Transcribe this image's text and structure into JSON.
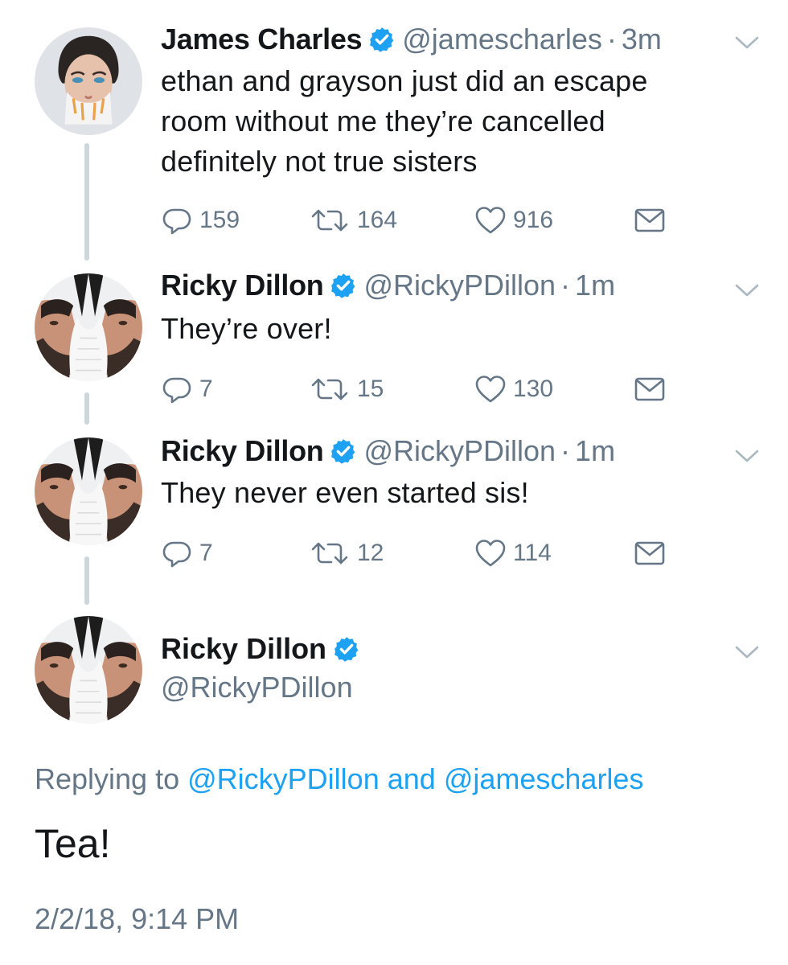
{
  "tweets": [
    {
      "name": "James Charles",
      "handle": "@jamescharles",
      "time": "3m",
      "text_lines": [
        "ethan and grayson just did an escape",
        "room without me they’re cancelled",
        "definitely not true sisters"
      ],
      "replies": "159",
      "retweets": "164",
      "likes": "916"
    },
    {
      "name": "Ricky Dillon",
      "handle": "@RickyPDillon",
      "time": "1m",
      "text_lines": [
        "They’re over!"
      ],
      "replies": "7",
      "retweets": "15",
      "likes": "130"
    },
    {
      "name": "Ricky Dillon",
      "handle": "@RickyPDillon",
      "time": "1m",
      "text_lines": [
        "They never even started sis!"
      ],
      "replies": "7",
      "retweets": "12",
      "likes": "114"
    }
  ],
  "separator": "·",
  "focus": {
    "name": "Ricky Dillon",
    "handle": "@RickyPDillon",
    "replying_prefix": "Replying to",
    "mention_1": "@RickyPDillon",
    "conjunction": "and",
    "mention_2": "@jamescharles",
    "text": "Tea!",
    "timestamp": "2/2/18, 9:14 PM"
  },
  "icons": {
    "verified": "verified-badge-icon",
    "reply": "reply-icon",
    "retweet": "retweet-icon",
    "like": "heart-icon",
    "dm": "envelope-icon",
    "caret": "chevron-down-icon"
  },
  "colors": {
    "text": "#14171a",
    "muted": "#657786",
    "link": "#1da1f2",
    "verified": "#1da1f2",
    "thread_line": "#ccd6dd"
  }
}
